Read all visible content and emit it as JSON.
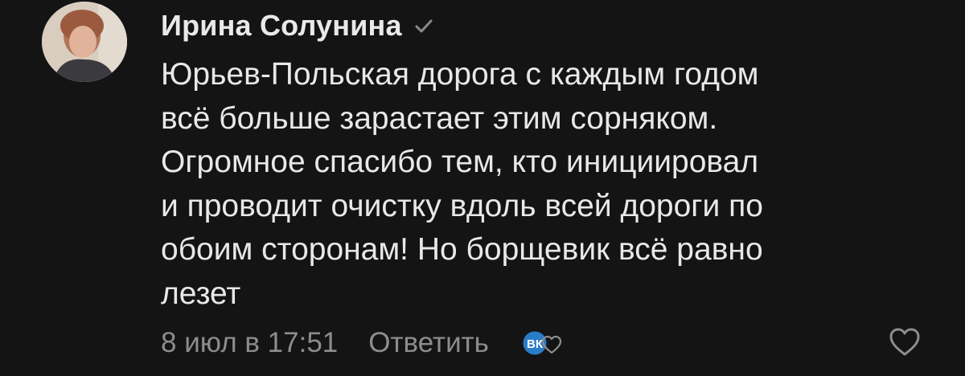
{
  "comment": {
    "author": "Ирина Солунина",
    "verified_icon": "check-icon",
    "text": "Юрьев-Польская дорога с каждым годом\nвсё больше зарастает этим сорняком.\nОгромное спасибо тем, кто инициировал\nи проводит очистку вдоль всей дороги по\nобоим сторонам! Но борщевик всё равно\nлезет",
    "date": "8 июл в 17:51",
    "reply_label": "Ответить",
    "badge_text": "ВК"
  },
  "colors": {
    "background": "#141414",
    "text": "#e8e8e8",
    "meta": "#8d8d8d",
    "badge_blue": "#2a7cc7"
  }
}
